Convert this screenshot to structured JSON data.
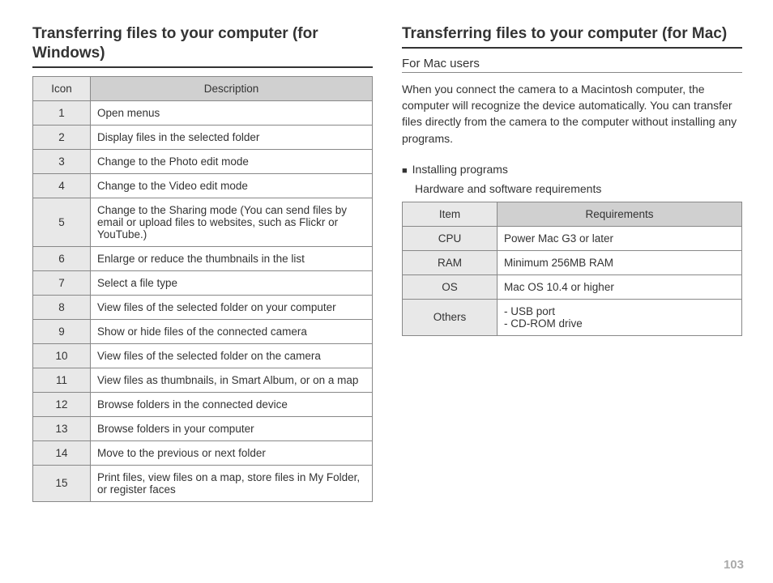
{
  "left": {
    "title": "Transferring files to your computer (for Windows)",
    "table": {
      "head_icon": "Icon",
      "head_desc": "Description",
      "rows": [
        {
          "n": "1",
          "d": "Open menus"
        },
        {
          "n": "2",
          "d": "Display files in the selected folder"
        },
        {
          "n": "3",
          "d": "Change to the Photo edit mode"
        },
        {
          "n": "4",
          "d": "Change to the Video edit mode"
        },
        {
          "n": "5",
          "d": "Change to the Sharing mode (You can send files by email or upload files to websites, such as Flickr or YouTube.)"
        },
        {
          "n": "6",
          "d": "Enlarge or reduce the thumbnails in the list"
        },
        {
          "n": "7",
          "d": "Select a file type"
        },
        {
          "n": "8",
          "d": "View files of the selected folder on your computer"
        },
        {
          "n": "9",
          "d": "Show or hide files of the connected camera"
        },
        {
          "n": "10",
          "d": "View files of the selected folder on the camera"
        },
        {
          "n": "11",
          "d": "View files as thumbnails, in Smart Album, or on a map"
        },
        {
          "n": "12",
          "d": "Browse folders in the connected device"
        },
        {
          "n": "13",
          "d": "Browse folders in your computer"
        },
        {
          "n": "14",
          "d": "Move to the previous or next folder"
        },
        {
          "n": "15",
          "d": "Print files, view files on a map, store files in My Folder, or register faces"
        }
      ]
    }
  },
  "right": {
    "title": "Transferring files to your computer (for Mac)",
    "subhead": "For Mac users",
    "body": "When you connect the camera to a Macintosh computer, the computer will recognize the device automatically. You can transfer files directly from the camera to the computer without installing any programs.",
    "install_heading": "Installing programs",
    "install_sub": "Hardware and software requirements",
    "table": {
      "head_item": "Item",
      "head_req": "Requirements",
      "rows": [
        {
          "item": "CPU",
          "req": "Power Mac G3 or later"
        },
        {
          "item": "RAM",
          "req": "Minimum 256MB RAM"
        },
        {
          "item": "OS",
          "req": "Mac OS 10.4 or higher"
        },
        {
          "item": "Others",
          "req": "- USB port\n- CD-ROM drive"
        }
      ]
    }
  },
  "page_number": "103"
}
